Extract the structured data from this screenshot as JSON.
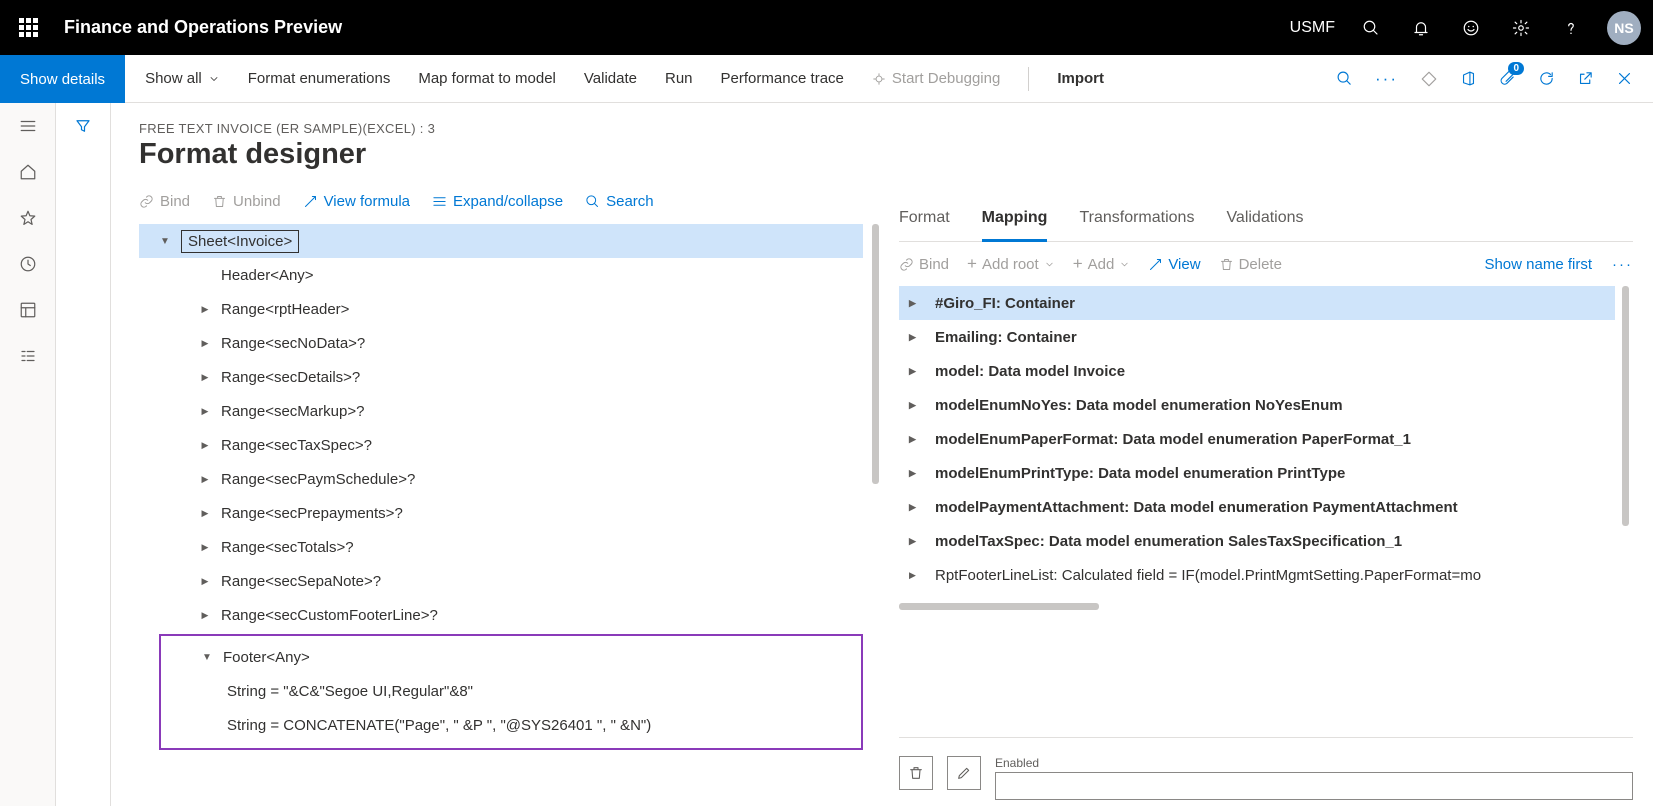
{
  "header": {
    "app_title": "Finance and Operations Preview",
    "company": "USMF",
    "avatar_initials": "NS"
  },
  "command_bar": {
    "show_details": "Show details",
    "show_all": "Show all",
    "format_enumerations": "Format enumerations",
    "map_format": "Map format to model",
    "validate": "Validate",
    "run": "Run",
    "performance_trace": "Performance trace",
    "start_debugging": "Start Debugging",
    "import": "Import",
    "attach_badge": "0"
  },
  "page": {
    "breadcrumb": "FREE TEXT INVOICE (ER SAMPLE)(EXCEL) : 3",
    "title": "Format designer"
  },
  "left_toolbar": {
    "bind": "Bind",
    "unbind": "Unbind",
    "view_formula": "View formula",
    "expand_collapse": "Expand/collapse",
    "search": "Search"
  },
  "format_tree": {
    "root": "Sheet<Invoice>",
    "children": [
      "Header<Any>",
      "Range<rptHeader>",
      "Range<secNoData>?",
      "Range<secDetails>?",
      "Range<secMarkup>?",
      "Range<secTaxSpec>?",
      "Range<secPaymSchedule>?",
      "Range<secPrepayments>?",
      "Range<secTotals>?",
      "Range<secSepaNote>?",
      "Range<secCustomFooterLine>?"
    ],
    "footer": {
      "label": "Footer<Any>",
      "lines": [
        "String = \"&C&\"Segoe UI,Regular\"&8\"",
        "String = CONCATENATE(\"Page\", \" &P \", \"@SYS26401 \", \" &N\")"
      ]
    }
  },
  "tabs": {
    "format": "Format",
    "mapping": "Mapping",
    "transformations": "Transformations",
    "validations": "Validations"
  },
  "right_toolbar": {
    "bind": "Bind",
    "add_root": "Add root",
    "add": "Add",
    "view": "View",
    "delete": "Delete",
    "show_name_first": "Show name first"
  },
  "mapping_tree": [
    "#Giro_FI: Container",
    "Emailing: Container",
    "model: Data model Invoice",
    "modelEnumNoYes: Data model enumeration NoYesEnum",
    "modelEnumPaperFormat: Data model enumeration PaperFormat_1",
    "modelEnumPrintType: Data model enumeration PrintType",
    "modelPaymentAttachment: Data model enumeration PaymentAttachment",
    "modelTaxSpec: Data model enumeration SalesTaxSpecification_1",
    "RptFooterLineList: Calculated field = IF(model.PrintMgmtSetting.PaperFormat=mo"
  ],
  "bottom": {
    "enabled_label": "Enabled"
  }
}
